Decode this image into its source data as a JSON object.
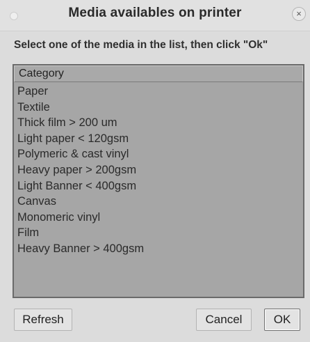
{
  "window": {
    "title": "Media availables on printer",
    "close_glyph": "×",
    "close_icon": "close-icon"
  },
  "instruction": "Select one of the media in the list, then click \"Ok\"",
  "list": {
    "header": "Category",
    "items": [
      "Paper",
      "Textile",
      "Thick film > 200 um",
      "Light paper < 120gsm",
      "Polymeric & cast vinyl",
      "Heavy paper > 200gsm",
      "Light Banner < 400gsm",
      "Canvas",
      "Monomeric vinyl",
      "Film",
      "Heavy Banner > 400gsm"
    ]
  },
  "buttons": {
    "refresh": "Refresh",
    "cancel": "Cancel",
    "ok": "OK"
  }
}
